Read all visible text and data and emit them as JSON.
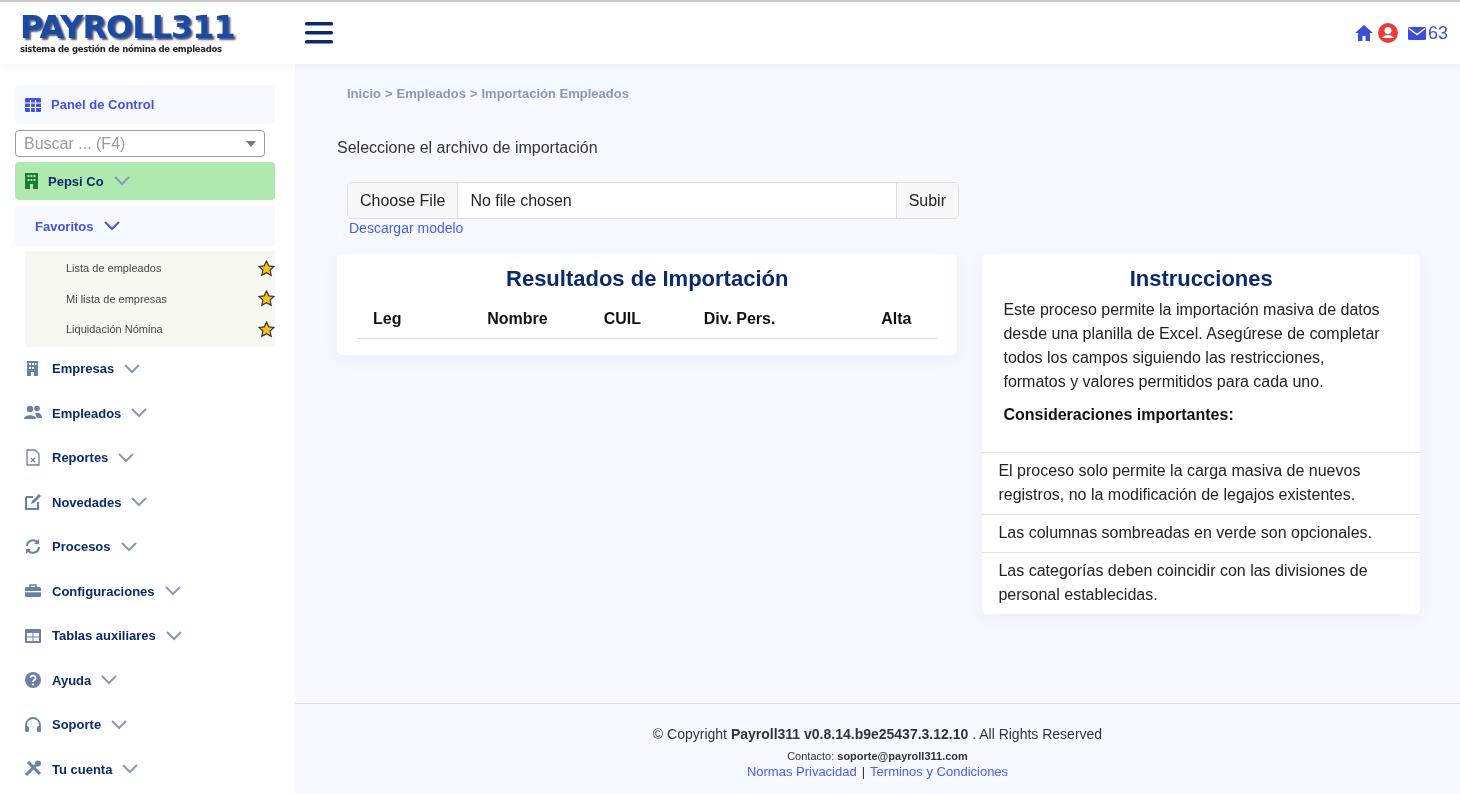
{
  "header": {
    "logo": {
      "title": "PAYROLL311",
      "subtitle": "sistema de gestión de nómina de empleados"
    },
    "message_count": "63"
  },
  "sidebar": {
    "dashboard": "Panel de Control",
    "search": {
      "placeholder": "Buscar ... (F4)"
    },
    "company": {
      "label": "Pepsi Co",
      "selected": true
    },
    "favorites": {
      "label": "Favoritos",
      "expanded": true,
      "items": [
        {
          "label": "Lista de empleados",
          "starred": true
        },
        {
          "label": "Mi lista de empresas",
          "starred": true
        },
        {
          "label": "Liquidación Nómina",
          "starred": true
        }
      ]
    },
    "items": [
      {
        "label": "Empresas"
      },
      {
        "label": "Empleados"
      },
      {
        "label": "Reportes"
      },
      {
        "label": "Novedades"
      },
      {
        "label": "Procesos"
      },
      {
        "label": "Configuraciones"
      },
      {
        "label": "Tablas auxiliares"
      },
      {
        "label": "Ayuda"
      },
      {
        "label": "Soporte"
      },
      {
        "label": "Tu cuenta"
      }
    ]
  },
  "breadcrumb": {
    "items": [
      "Inicio",
      "Empleados",
      "Importación Empleados"
    ],
    "separator": ">"
  },
  "import": {
    "label": "Seleccione el archivo de importación",
    "choose_button": "Choose File",
    "file_status": "No file chosen",
    "upload_button": "Subir",
    "template_link": "Descargar modelo"
  },
  "results": {
    "title": "Resultados de Importación",
    "columns": [
      "Leg",
      "Nombre",
      "CUIL",
      "Div. Pers.",
      "Alta"
    ]
  },
  "instructions": {
    "title": "Instrucciones",
    "intro": "Este proceso permite la importación masiva de datos desde una planilla de Excel. Asegúrese de completar todos los campos siguiendo las restricciones, formatos y valores permitidos para cada uno.",
    "subtitle": "Consideraciones importantes:",
    "notes": [
      "El proceso solo permite la carga masiva de nuevos registros, no la modificación de legajos existentes.",
      "Las columnas sombreadas en verde son opcionales.",
      "Las categorías deben coincidir con las divisiones de personal establecidas."
    ]
  },
  "footer": {
    "copyright": "© Copyright **Payroll311 v0.8.14.b9e25437.3.12.10** . All Rights Reserved",
    "contact": "Contacto: **soporte@payroll311.com**",
    "links": [
      "Normas Privacidad",
      "Terminos y Condiciones"
    ],
    "separator": "|"
  }
}
